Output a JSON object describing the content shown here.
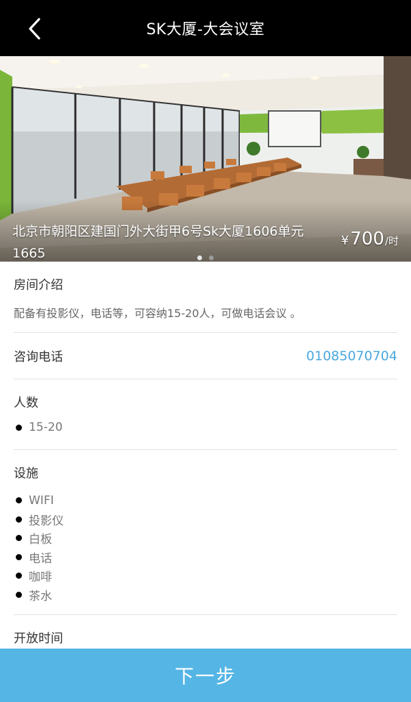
{
  "header": {
    "title": "SK大厦-大会议室"
  },
  "hero": {
    "address": "北京市朝阳区建国门外大街甲6号Sk大厦1606单元1665",
    "price": {
      "currency": "¥",
      "amount": "700",
      "unit": "/时"
    },
    "carousel": {
      "page_count": 2,
      "active_index": 0
    }
  },
  "sections": {
    "intro": {
      "title": "房间介绍",
      "text": "配备有投影仪，电话等，可容纳15-20人，可做电话会议 。"
    },
    "phone": {
      "title": "咨询电话",
      "number": "01085070704"
    },
    "people": {
      "title": "人数",
      "items": [
        "15-20"
      ]
    },
    "facilities": {
      "title": "设施",
      "items": [
        "WIFI",
        "投影仪",
        "白板",
        "电话",
        "咖啡",
        "茶水"
      ]
    },
    "hours": {
      "title": "开放时间"
    }
  },
  "footer": {
    "next_label": "下一步"
  },
  "colors": {
    "topbar": "#000000",
    "accent": "#55b5e5",
    "phone": "#4aa8de"
  }
}
